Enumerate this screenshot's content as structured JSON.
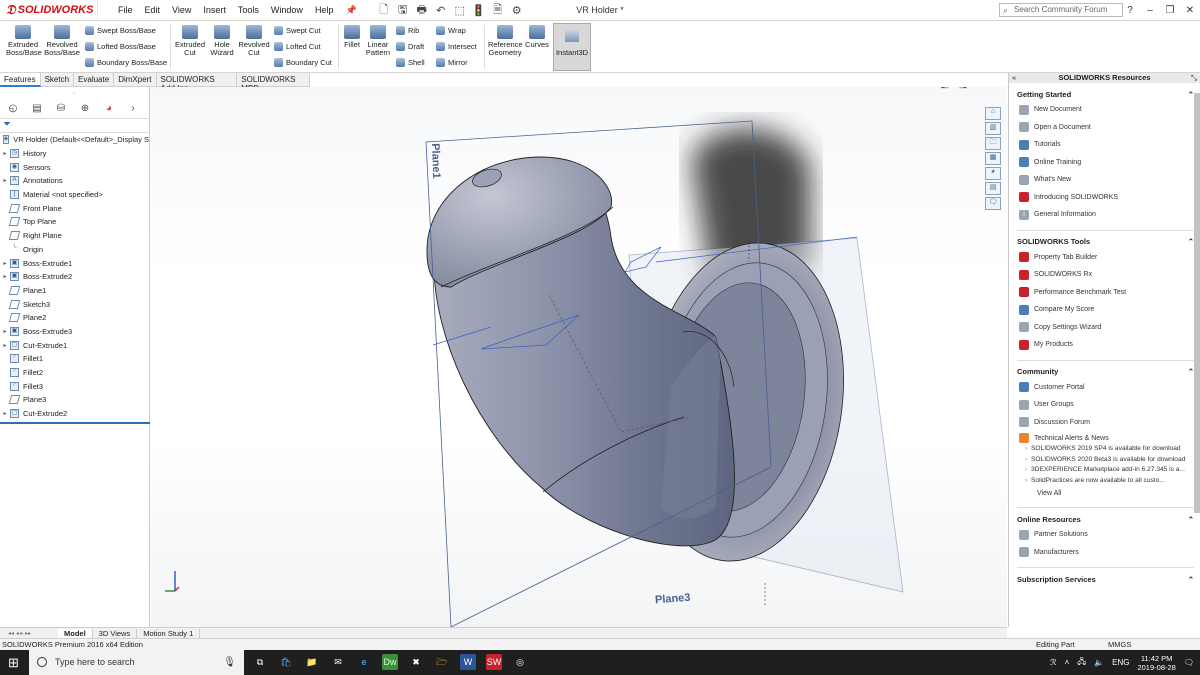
{
  "app": {
    "logo": "SOLIDWORKS",
    "doc_title": "VR Holder *",
    "search_placeholder": "Search Community Forum"
  },
  "menu": [
    "File",
    "Edit",
    "View",
    "Insert",
    "Tools",
    "Window",
    "Help"
  ],
  "ribbon": {
    "extruded_boss": "Extruded Boss/Base",
    "revolved_boss": "Revolved Boss/Base",
    "swept_boss": "Swept Boss/Base",
    "lofted_boss": "Lofted Boss/Base",
    "boundary_boss": "Boundary Boss/Base",
    "extruded_cut": "Extruded Cut",
    "hole_wizard": "Hole Wizard",
    "revolved_cut": "Revolved Cut",
    "swept_cut": "Swept Cut",
    "lofted_cut": "Lofted Cut",
    "boundary_cut": "Boundary Cut",
    "fillet": "Fillet",
    "linear_pattern": "Linear Pattern",
    "rib": "Rib",
    "draft": "Draft",
    "shell": "Shell",
    "wrap": "Wrap",
    "intersect": "Intersect",
    "mirror": "Mirror",
    "reference_geometry": "Reference Geometry",
    "curves": "Curves",
    "instant3d": "Instant3D"
  },
  "tabs": [
    "Features",
    "Sketch",
    "Evaluate",
    "DimXpert",
    "SOLIDWORKS Add-Ins",
    "SOLIDWORKS MBD"
  ],
  "tree": {
    "root": "VR Holder  (Default<<Default>_Display S",
    "items": [
      {
        "label": "History",
        "exp": true
      },
      {
        "label": "Sensors",
        "exp": false
      },
      {
        "label": "Annotations",
        "exp": true
      },
      {
        "label": "Material <not specified>",
        "exp": false
      },
      {
        "label": "Front Plane",
        "exp": false
      },
      {
        "label": "Top Plane",
        "exp": false
      },
      {
        "label": "Right Plane",
        "exp": false
      },
      {
        "label": "Origin",
        "exp": false
      },
      {
        "label": "Boss-Extrude1",
        "exp": true
      },
      {
        "label": "Boss-Extrude2",
        "exp": true
      },
      {
        "label": "Plane1",
        "exp": false
      },
      {
        "label": "Sketch3",
        "exp": false
      },
      {
        "label": "Plane2",
        "exp": false
      },
      {
        "label": "Boss-Extrude3",
        "exp": true
      },
      {
        "label": "Cut-Extrude1",
        "exp": true
      },
      {
        "label": "Fillet1",
        "exp": false
      },
      {
        "label": "Fillet2",
        "exp": false
      },
      {
        "label": "Fillet3",
        "exp": false
      },
      {
        "label": "Plane3",
        "exp": false
      },
      {
        "label": "Cut-Extrude2",
        "exp": true
      }
    ]
  },
  "viewport": {
    "plane1": "Plane1",
    "plane3": "Plane3"
  },
  "resources": {
    "title": "SOLIDWORKS Resources",
    "getting_started": {
      "title": "Getting Started",
      "items": [
        "New Document",
        "Open a Document",
        "Tutorials",
        "Online Training",
        "What's New",
        "Introducing SOLIDWORKS",
        "General Information"
      ]
    },
    "tools": {
      "title": "SOLIDWORKS Tools",
      "items": [
        "Property Tab Builder",
        "SOLIDWORKS Rx",
        "Performance Benchmark Test",
        "Compare My Score",
        "Copy Settings Wizard",
        "My Products"
      ]
    },
    "community": {
      "title": "Community",
      "items": [
        "Customer Portal",
        "User Groups",
        "Discussion Forum",
        "Technical Alerts & News"
      ],
      "news": [
        "SOLIDWORKS 2019 SP4 is available for download",
        "SOLIDWORKS 2020 Beta3 is available for download",
        "3DEXPERIENCE Marketplace add-in 6.27.345 is a...",
        "SolidPractices are now available to all custo..."
      ],
      "view_all": "View All"
    },
    "online": {
      "title": "Online Resources",
      "items": [
        "Partner Solutions",
        "Manufacturers"
      ]
    },
    "subscription": {
      "title": "Subscription Services"
    }
  },
  "bottom_tabs": [
    "Model",
    "3D Views",
    "Motion Study 1"
  ],
  "status": {
    "left": "SOLIDWORKS Premium 2016 x64 Edition",
    "mode": "Editing Part",
    "units": "MMGS"
  },
  "taskbar": {
    "search": "Type here to search",
    "lang": "ENG",
    "time": "11:42 PM",
    "date": "2019-08-28"
  }
}
